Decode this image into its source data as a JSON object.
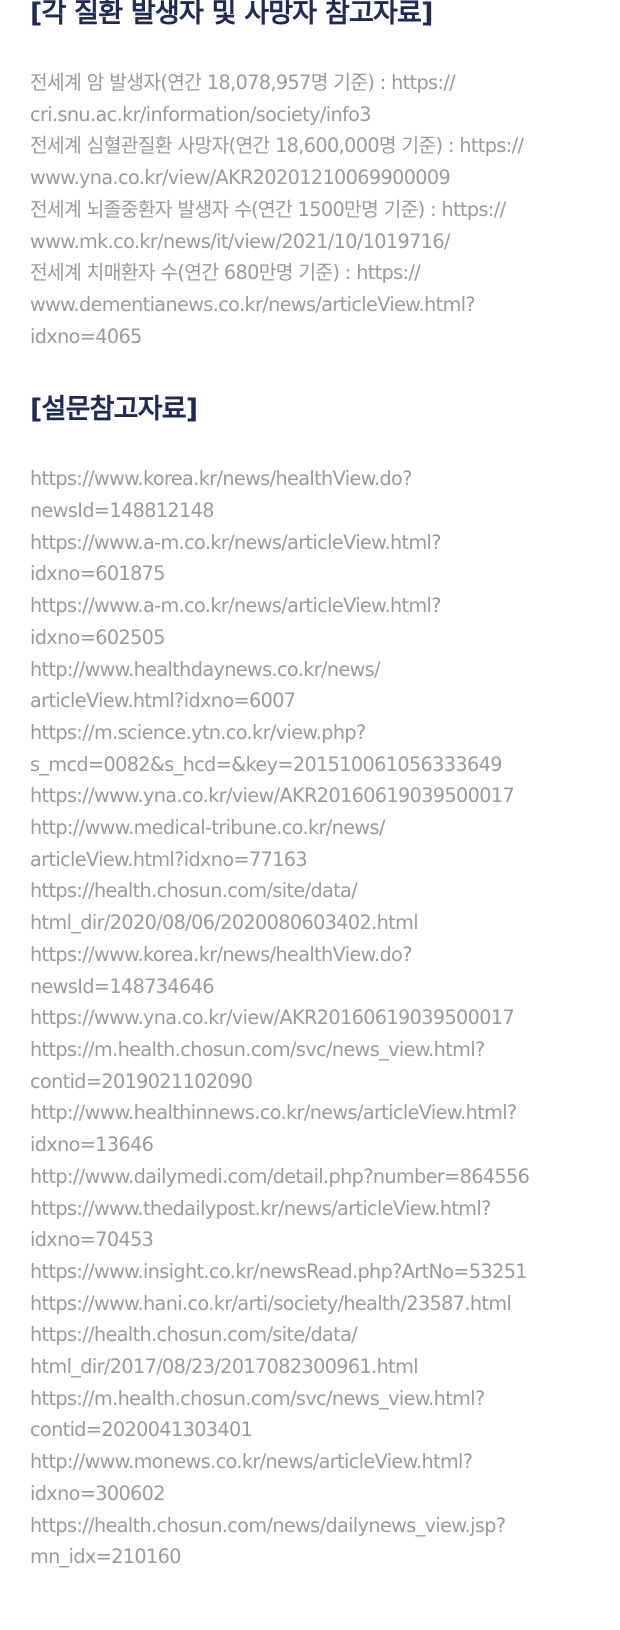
{
  "sections": [
    {
      "title": "[각 질환 발생자 및 사망자 참고자료]",
      "lines": [
        "전세계 암 발생자(연간 18,078,957명 기준) : https://",
        "cri.snu.ac.kr/information/society/info3",
        "전세계 심혈관질환 사망자(연간 18,600,000명 기준) : https://",
        "www.yna.co.kr/view/AKR20201210069900009",
        "전세계 뇌졸중환자 발생자 수(연간 1500만명 기준) : https://",
        "www.mk.co.kr/news/it/view/2021/10/1019716/",
        "전세계 치매환자 수(연간 680만명 기준) : https://",
        "www.dementianews.co.kr/news/articleView.html?",
        "idxno=4065"
      ]
    },
    {
      "title": "[설문참고자료]",
      "lines": [
        "https://www.korea.kr/news/healthView.do?",
        "newsId=148812148",
        "https://www.a-m.co.kr/news/articleView.html?",
        "idxno=601875",
        "https://www.a-m.co.kr/news/articleView.html?",
        "idxno=602505",
        "http://www.healthdaynews.co.kr/news/",
        "articleView.html?idxno=6007",
        "https://m.science.ytn.co.kr/view.php?",
        "s_mcd=0082&s_hcd=&key=201510061056333649",
        "https://www.yna.co.kr/view/AKR20160619039500017",
        "http://www.medical-tribune.co.kr/news/",
        "articleView.html?idxno=77163",
        "https://health.chosun.com/site/data/",
        "html_dir/2020/08/06/2020080603402.html",
        "https://www.korea.kr/news/healthView.do?",
        "newsId=148734646",
        "https://www.yna.co.kr/view/AKR20160619039500017",
        "https://m.health.chosun.com/svc/news_view.html?",
        "contid=2019021102090",
        "http://www.healthinnews.co.kr/news/articleView.html?",
        "idxno=13646",
        "http://www.dailymedi.com/detail.php?number=864556",
        "https://www.thedailypost.kr/news/articleView.html?",
        "idxno=70453",
        "https://www.insight.co.kr/newsRead.php?ArtNo=53251",
        "https://www.hani.co.kr/arti/society/health/23587.html",
        "https://health.chosun.com/site/data/",
        "html_dir/2017/08/23/2017082300961.html",
        "https://m.health.chosun.com/svc/news_view.html?",
        "contid=2020041303401",
        "http://www.monews.co.kr/news/articleView.html?",
        "idxno=300602",
        "https://health.chosun.com/news/dailynews_view.jsp?",
        "mn_idx=210160"
      ]
    }
  ]
}
